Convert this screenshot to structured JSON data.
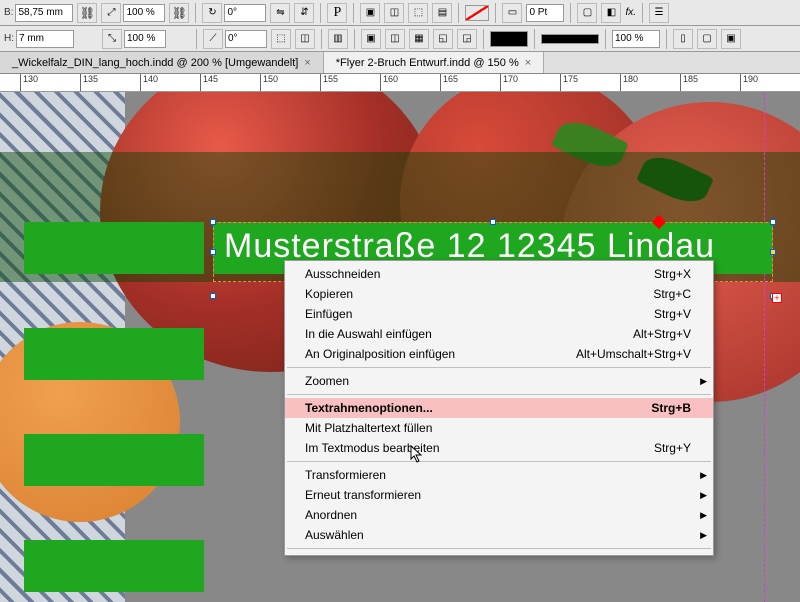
{
  "toolbar": {
    "b_label": "B:",
    "b_value": "58,75 mm",
    "h_label": "H:",
    "h_value": "7 mm",
    "pct_w": "100 %",
    "pct_h": "100 %",
    "rotate": "0°",
    "stroke": "0 Pt",
    "zoom": "100 %"
  },
  "tabs": [
    {
      "label": "_Wickelfalz_DIN_lang_hoch.indd @ 200 % [Umgewandelt]"
    },
    {
      "label": "*Flyer 2-Bruch Entwurf.indd @ 150 %"
    }
  ],
  "ruler_marks": [
    "130",
    "135",
    "140",
    "145",
    "150",
    "155",
    "160",
    "165",
    "170",
    "175",
    "180",
    "185",
    "190"
  ],
  "text_frame": {
    "content": "Musterstraße 12  12345 Lindau"
  },
  "menu": {
    "items": [
      {
        "label": "Ausschneiden",
        "shortcut": "Strg+X"
      },
      {
        "label": "Kopieren",
        "shortcut": "Strg+C"
      },
      {
        "label": "Einfügen",
        "shortcut": "Strg+V"
      },
      {
        "label": "In die Auswahl einfügen",
        "shortcut": "Alt+Strg+V"
      },
      {
        "label": "An Originalposition einfügen",
        "shortcut": "Alt+Umschalt+Strg+V"
      }
    ],
    "zoom": "Zoomen",
    "items2": [
      {
        "label": "Textrahmenoptionen...",
        "shortcut": "Strg+B"
      },
      {
        "label": "Mit Platzhaltertext füllen",
        "shortcut": ""
      },
      {
        "label": "Im Textmodus bearbeiten",
        "shortcut": "Strg+Y"
      }
    ],
    "items3": [
      {
        "label": "Transformieren"
      },
      {
        "label": "Erneut transformieren"
      },
      {
        "label": "Anordnen"
      },
      {
        "label": "Auswählen"
      }
    ]
  }
}
